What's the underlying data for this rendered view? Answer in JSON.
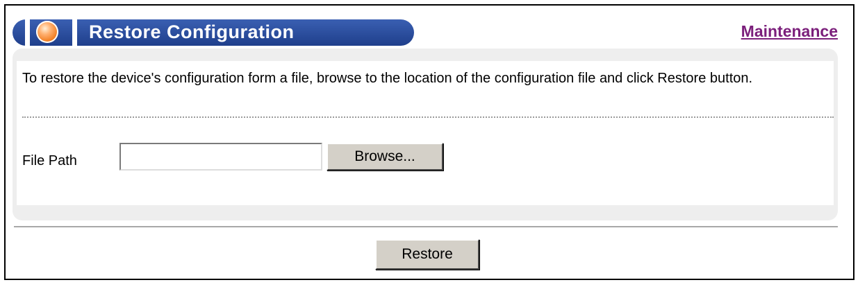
{
  "header": {
    "title": "Restore Configuration",
    "maintenance_link": "Maintenance",
    "title_color": "#1f3f8c",
    "link_color": "#7b1f7b"
  },
  "panel": {
    "description": "To restore the device's configuration form a file, browse to the location of the configuration file and click Restore button.",
    "file_path_label": "File Path",
    "file_path_value": "",
    "browse_label": "Browse..."
  },
  "footer": {
    "restore_label": "Restore"
  },
  "icons": {
    "title_orb": "orb-icon"
  }
}
